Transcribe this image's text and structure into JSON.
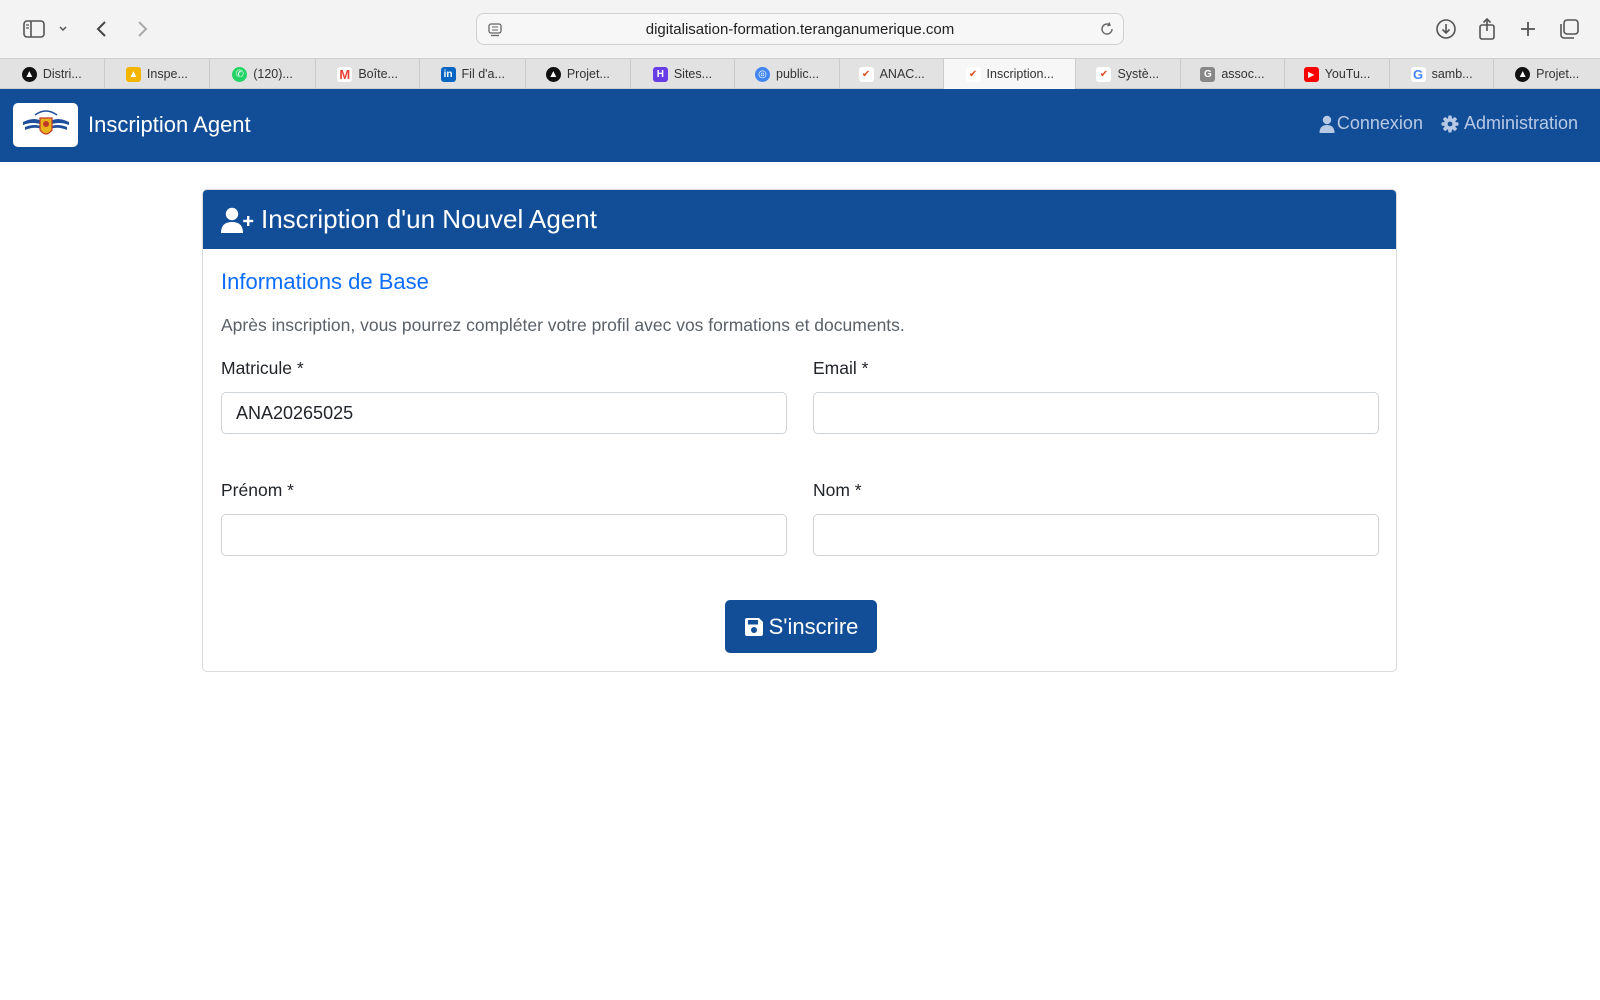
{
  "browser": {
    "url": "digitalisation-formation.teranganumerique.com",
    "tabs": [
      {
        "label": "Distri...",
        "icon": "triangle-icon",
        "color": "#111111"
      },
      {
        "label": "Inspe...",
        "icon": "ads-icon",
        "color": "#f4b400"
      },
      {
        "label": "(120)...",
        "icon": "whatsapp-icon",
        "color": "#25d366"
      },
      {
        "label": "Boîte...",
        "icon": "gmail-icon",
        "color": "#ea4335"
      },
      {
        "label": "Fil d'a...",
        "icon": "linkedin-icon",
        "color": "#0a66c2"
      },
      {
        "label": "Projet...",
        "icon": "triangle-icon",
        "color": "#111111"
      },
      {
        "label": "Sites...",
        "icon": "hostinger-icon",
        "color": "#673de6"
      },
      {
        "label": "public...",
        "icon": "globe-icon",
        "color": "#4285f4"
      },
      {
        "label": "ANAC...",
        "icon": "anac-icon",
        "color": "#e34d26"
      },
      {
        "label": "Inscription...",
        "icon": "anac-icon",
        "color": "#e34d26",
        "active": true
      },
      {
        "label": "Systè...",
        "icon": "anac-icon",
        "color": "#e34d26"
      },
      {
        "label": "assoc...",
        "icon": "g-icon",
        "color": "#888888"
      },
      {
        "label": "YouTu...",
        "icon": "youtube-icon",
        "color": "#ff0000"
      },
      {
        "label": "samb...",
        "icon": "google-icon",
        "color": "#4285f4"
      },
      {
        "label": "Projet...",
        "icon": "triangle-icon",
        "color": "#111111"
      }
    ]
  },
  "navbar": {
    "brand": "Inscription Agent",
    "links": {
      "login": "Connexion",
      "admin": "Administration"
    }
  },
  "card": {
    "title": "Inscription d'un Nouvel Agent",
    "section_title": "Informations de Base",
    "intro": "Après inscription, vous pourrez compléter votre profil avec vos formations et documents.",
    "fields": {
      "matricule": {
        "label": "Matricule *",
        "value": "ANA20265025"
      },
      "email": {
        "label": "Email *",
        "value": ""
      },
      "prenom": {
        "label": "Prénom *",
        "value": ""
      },
      "nom": {
        "label": "Nom *",
        "value": ""
      }
    },
    "submit_label": "S'inscrire"
  },
  "colors": {
    "primary": "#124e98",
    "accent": "#0d6efd"
  }
}
